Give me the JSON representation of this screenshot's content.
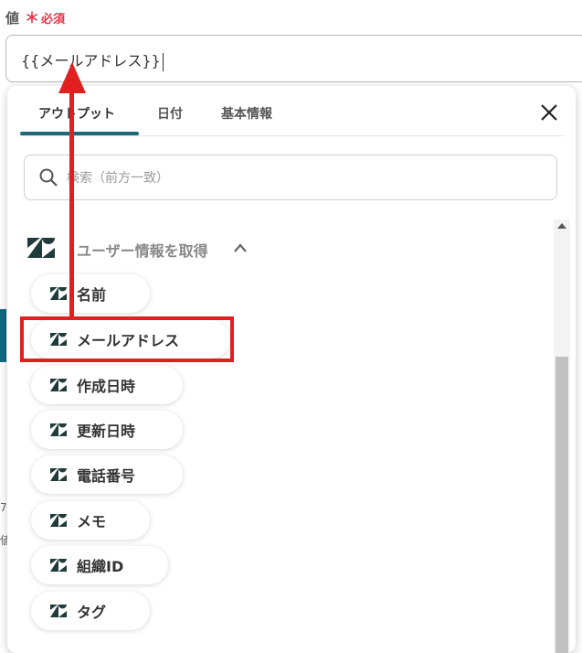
{
  "field": {
    "label": "値",
    "required_star": "＊",
    "required_text": "必須",
    "value": "{{メールアドレス}}"
  },
  "background_fragments": [
    "7",
    "値"
  ],
  "popup": {
    "tabs": [
      {
        "label": "アウトプット",
        "active": true
      },
      {
        "label": "日付",
        "active": false
      },
      {
        "label": "基本情報",
        "active": false
      }
    ],
    "search_placeholder": "検索（前方一致）",
    "section_title": "ユーザー情報を取得",
    "items": [
      {
        "label": "名前"
      },
      {
        "label": "メールアドレス"
      },
      {
        "label": "作成日時"
      },
      {
        "label": "更新日時"
      },
      {
        "label": "電話番号"
      },
      {
        "label": "メモ"
      },
      {
        "label": "組織ID"
      },
      {
        "label": "タグ"
      }
    ]
  },
  "colors": {
    "accent": "#1e6878",
    "required": "#e8334a",
    "annotation": "#e02020",
    "logo": "#1f3b3c"
  },
  "icons": {
    "close": "close-icon",
    "search": "search-icon",
    "logo": "zendesk-logo-icon",
    "collapse": "chevron-up-icon"
  }
}
